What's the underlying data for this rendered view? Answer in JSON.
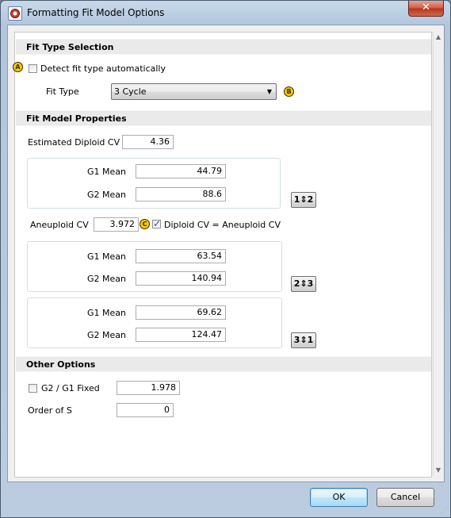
{
  "window": {
    "title": "Formatting Fit Model Options",
    "close_glyph": "✕"
  },
  "fit_type": {
    "section_title": "Fit Type Selection",
    "auto_detect_label": "Detect fit type automatically",
    "auto_detect_checked": false,
    "fit_type_label": "Fit Type",
    "fit_type_value": "3 Cycle"
  },
  "fit_model": {
    "section_title": "Fit Model Properties",
    "estimated_diploid_cv_label": "Estimated Diploid CV",
    "estimated_diploid_cv": "4.36",
    "cycle1": {
      "g1_label": "G1 Mean",
      "g1": "44.79",
      "g2_label": "G2 Mean",
      "g2": "88.6"
    },
    "swap12": "1⇕2",
    "aneuploid_cv_label": "Aneuploid CV",
    "aneuploid_cv": "3.972",
    "diploid_equals_label": "Diploid CV = Aneuploid CV",
    "diploid_equals_checked": true,
    "cycle2": {
      "g1_label": "G1 Mean",
      "g1": "63.54",
      "g2_label": "G2 Mean",
      "g2": "140.94"
    },
    "swap23": "2⇕3",
    "cycle3": {
      "g1_label": "G1 Mean",
      "g1": "69.62",
      "g2_label": "G2 Mean",
      "g2": "124.47"
    },
    "swap31": "3⇕1"
  },
  "other": {
    "section_title": "Other Options",
    "g2g1_fixed_label": "G2 / G1 Fixed",
    "g2g1_fixed_checked": false,
    "g2g1_value": "1.978",
    "order_of_s_label": "Order of S",
    "order_of_s": "0"
  },
  "badges": {
    "a": "A",
    "b": "B",
    "c": "C"
  },
  "buttons": {
    "ok": "OK",
    "cancel": "Cancel"
  },
  "icons": {
    "app": "app-logo-icon",
    "close": "close-icon",
    "dropdown": "chevron-down-icon"
  },
  "colors": {
    "badge": "#f5c800",
    "accent": "#3c7fb1"
  }
}
